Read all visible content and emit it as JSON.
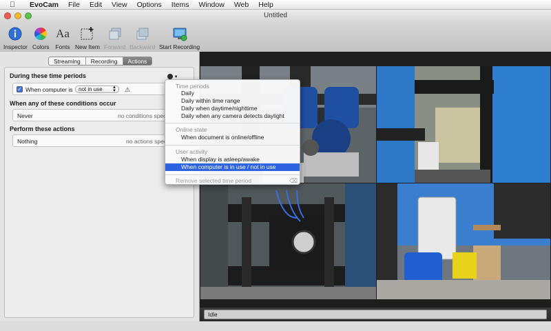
{
  "menubar": {
    "app": "EvoCam",
    "items": [
      "File",
      "Edit",
      "View",
      "Options",
      "Items",
      "Window",
      "Web",
      "Help"
    ]
  },
  "window": {
    "title": "Untitled"
  },
  "toolbar": {
    "inspector": "Inspector",
    "colors": "Colors",
    "fonts": "Fonts",
    "fonts_glyph": "Aa",
    "new_item": "New Item",
    "forward": "Forward",
    "backward": "Backward",
    "start_recording": "Start Recording"
  },
  "tabs": {
    "streaming": "Streaming",
    "recording": "Recording",
    "actions": "Actions",
    "active": "Actions"
  },
  "panel": {
    "time_periods_title": "During these time periods",
    "condition_label": "When computer is",
    "condition_value": "not in use",
    "conditions_title": "When any of these conditions occur",
    "conditions_value": "Never",
    "conditions_note": "no conditions spec",
    "actions_title": "Perform these actions",
    "actions_value": "Nothing",
    "actions_note": "no actions spec"
  },
  "menu": {
    "time_periods_header": "Time periods",
    "daily": "Daily",
    "daily_range": "Daily within time range",
    "daily_daynight": "Daily when daytime/nighttime",
    "daily_daylight": "Daily when any camera detects daylight",
    "online_header": "Online state",
    "online_item": "When document is online/offline",
    "user_header": "User activity",
    "display_item": "When display is asleep/awake",
    "computer_item": "When computer is in use / not in use",
    "remove_item": "Remove selected time period",
    "selected": "When computer is in use / not in use"
  },
  "status": {
    "text": "Idle"
  },
  "colors": {
    "menu_selection": "#2d62e0",
    "accent_blue": "#3a77d9"
  },
  "icons": [
    "apple-icon",
    "info-icon",
    "color-wheel-icon",
    "fonts-icon",
    "new-item-icon",
    "forward-icon",
    "backward-icon",
    "record-icon",
    "clock-icon",
    "warning-icon",
    "remove-icon"
  ]
}
